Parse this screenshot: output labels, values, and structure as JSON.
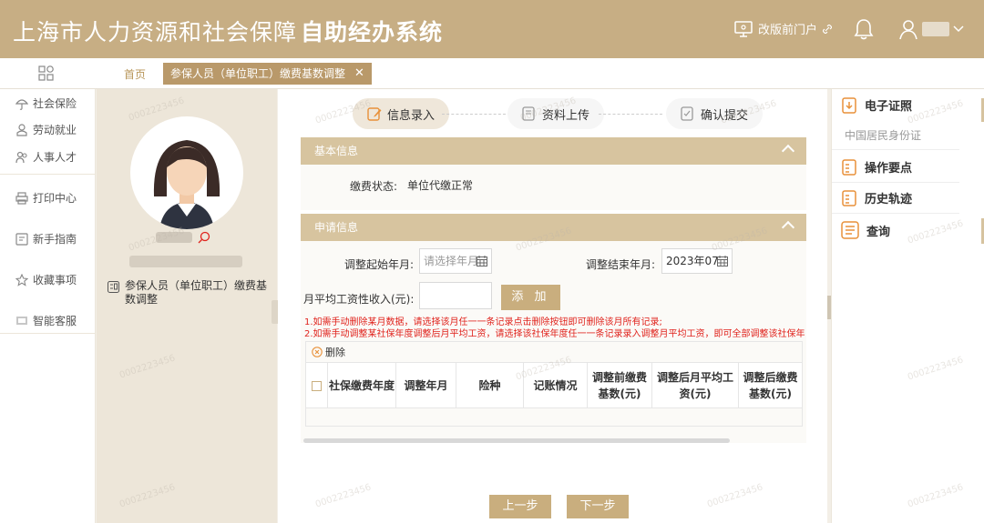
{
  "header": {
    "title_main": "上海市人力资源和社会保障",
    "title_bold": "自助经办系统",
    "portal_label": "改版前门户"
  },
  "tabs": {
    "home": "首页",
    "active": "参保人员（单位职工）缴费基数调整"
  },
  "nav": {
    "items": [
      "社会保险",
      "劳动就业",
      "人事人才",
      "打印中心",
      "新手指南",
      "收藏事项",
      "智能客服"
    ]
  },
  "profile": {
    "business_item": "参保人员（单位职工）缴费基数调整"
  },
  "steps": [
    "信息录入",
    "资料上传",
    "确认提交"
  ],
  "basic_info": {
    "title": "基本信息",
    "status_label": "缴费状态:",
    "status_value": "单位代缴正常"
  },
  "apply_info": {
    "title": "申请信息",
    "start_label": "调整起始年月:",
    "start_placeholder": "请选择年月",
    "end_label": "调整结束年月:",
    "end_value": "2023年07",
    "income_label": "月平均工资性收入(元):",
    "add_button": "添 加",
    "notes": [
      "1.如需手动删除某月数据，请选择该月任一一条记录点击删除按钮即可删除该月所有记录;",
      "2.如需手动调整某社保年度调整后月平均工资，请选择该社保年度任一一条记录录入调整月平均工资，即可全部调整该社保年"
    ],
    "delete_label": "删除",
    "columns": [
      "社保缴费年度",
      "调整年月",
      "险种",
      "记账情况",
      "调整前缴费基数(元)",
      "调整后月平均工资(元)",
      "调整后缴费基数(元)"
    ]
  },
  "buttons": {
    "prev": "上一步",
    "next": "下一步"
  },
  "right_panel": {
    "cert_title": "电子证照",
    "cert_sub": "中国居民身份证",
    "ops": "操作要点",
    "history": "历史轨迹",
    "query": "查询"
  },
  "watermark": "0002223456",
  "colors": {
    "brand": "#c7ae84",
    "section_header": "#d7c49f",
    "button": "#c9ae7e",
    "note_red": "#e0231d"
  }
}
